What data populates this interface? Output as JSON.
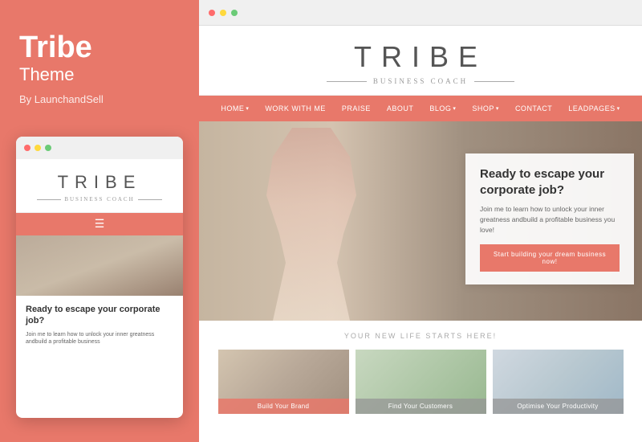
{
  "left": {
    "title": "Tribe",
    "subtitle": "Theme",
    "by": "By LaunchandSell"
  },
  "mobile": {
    "logo": "TRIBE",
    "sub": "BUSINESS COACH",
    "heading": "Ready to escape your corporate job?",
    "body": "Join me to learn how to unlock your inner greatness andbuild a profitable business"
  },
  "desktop": {
    "logo": "TRIBE",
    "sub": "BUSINESS COACH",
    "nav": [
      {
        "label": "HOME",
        "dropdown": true
      },
      {
        "label": "WORK WITH ME",
        "dropdown": false
      },
      {
        "label": "PRAISE",
        "dropdown": false
      },
      {
        "label": "ABOUT",
        "dropdown": false
      },
      {
        "label": "BLOG",
        "dropdown": true
      },
      {
        "label": "SHOP",
        "dropdown": true
      },
      {
        "label": "CONTACT",
        "dropdown": false
      },
      {
        "label": "LEADPAGES",
        "dropdown": true
      }
    ],
    "hero": {
      "title": "Ready to escape your corporate job?",
      "desc": "Join me to learn how to unlock your inner greatness andbuild a profitable business you love!",
      "btn": "Start building your dream business now!"
    },
    "section": {
      "subtitle": "YOUR NEW LIFE STARTS HERE!",
      "cards": [
        {
          "label": "Build Your Brand"
        },
        {
          "label": "Find Your Customers"
        },
        {
          "label": "Optimise Your Productivity"
        }
      ]
    }
  },
  "browser": {
    "dots": [
      "red",
      "yellow",
      "green"
    ]
  }
}
